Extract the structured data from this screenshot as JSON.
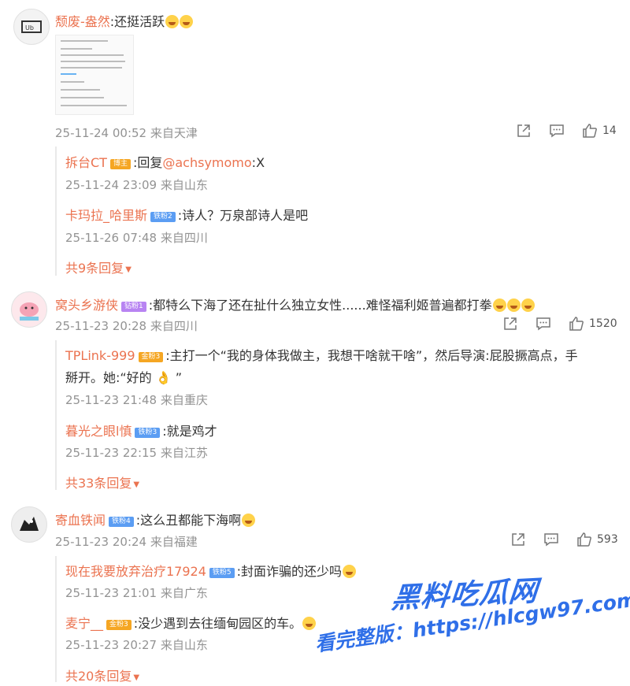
{
  "comments": [
    {
      "user": "颓废-盎然",
      "text": ":还挺活跃",
      "meta": "25-11-24 00:52 来自天津",
      "likes": "14",
      "replies": [
        {
          "user": "拆台CT",
          "badge": "博主",
          "text_prefix": ":回复",
          "mention": "@achsymomo",
          "text_suffix": ":X",
          "meta": "25-11-24 23:09 来自山东"
        },
        {
          "user": "卡玛拉_哈里斯",
          "badge": "铁粉2",
          "text": ":诗人？万泉部诗人是吧",
          "meta": "25-11-26 07:48 来自四川"
        }
      ],
      "more": "共9条回复"
    },
    {
      "user": "窝头乡游侠",
      "badge": "钻粉1",
      "text": ":都特么下海了还在扯什么独立女性......难怪福利姬普遍都打拳",
      "meta": "25-11-23 20:28 来自四川",
      "likes": "1520",
      "replies": [
        {
          "user": "TPLink-999",
          "badge": "金粉3",
          "text": ":主打一个“我的身体我做主，我想干啥就干啥”，然后导演:屁股撅高点，手",
          "text2": "掰开。她:“好的 👌 ”",
          "meta": "25-11-23 21:48 来自重庆"
        },
        {
          "user": "暮光之眼l慎",
          "badge": "铁粉3",
          "text": ":就是鸡才",
          "meta": "25-11-23 22:15 来自江苏"
        }
      ],
      "more": "共33条回复"
    },
    {
      "user": "寄血铁闻",
      "badge": "铁粉4",
      "text": ":这么丑都能下海啊",
      "meta": "25-11-23 20:24 来自福建",
      "likes": "593",
      "replies": [
        {
          "user": "现在我要放弃治疗17924",
          "badge": "铁粉5",
          "text": ":封面诈骗的还少吗",
          "meta": "25-11-23 21:01 来自广东"
        },
        {
          "user": "麦宁__",
          "badge": "金粉3",
          "text": ":没少遇到去往缅甸园区的车。",
          "meta": "25-11-23 20:27 来自山东"
        }
      ],
      "more": "共20条回复"
    }
  ],
  "watermark": {
    "line1": "黑料吃瓜网",
    "line2": "看完整版：https://hlcgw97.com"
  },
  "colors": {
    "name": "#eb7350",
    "meta": "#939393",
    "watermark": "#2f6fe8"
  }
}
